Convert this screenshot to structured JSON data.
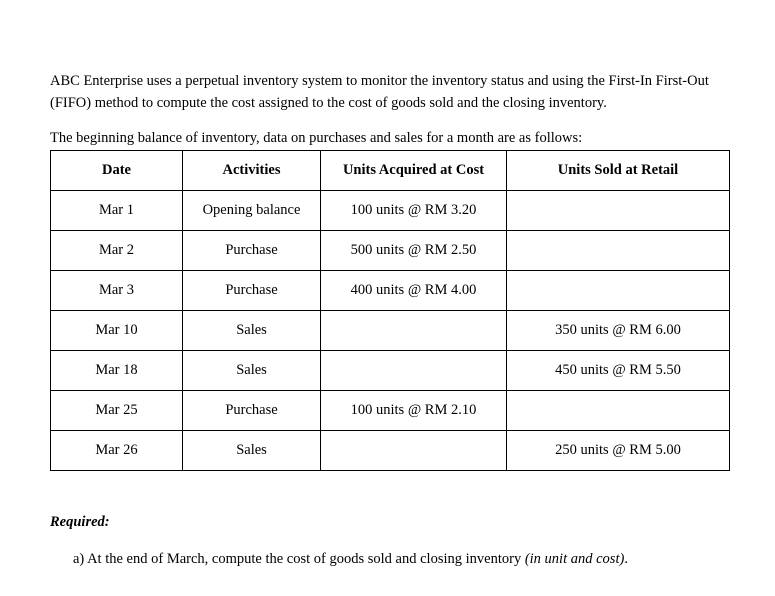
{
  "document": {
    "intro_paragraph": "ABC Enterprise uses a perpetual inventory system to monitor the inventory status and using the First-In First-Out (FIFO) method to compute the cost assigned to the cost of goods sold and the closing inventory.",
    "lead_in": "The beginning balance of inventory, data on purchases and sales for a month are as follows:"
  },
  "table": {
    "headers": {
      "date": "Date",
      "activities": "Activities",
      "acquired": "Units Acquired at Cost",
      "sold": "Units Sold at Retail"
    },
    "rows": [
      {
        "date": "Mar 1",
        "activity": "Opening balance",
        "acquired": "100 units @ RM 3.20",
        "sold": ""
      },
      {
        "date": "Mar 2",
        "activity": "Purchase",
        "acquired": "500 units @ RM 2.50",
        "sold": ""
      },
      {
        "date": "Mar 3",
        "activity": "Purchase",
        "acquired": "400 units @ RM 4.00",
        "sold": ""
      },
      {
        "date": "Mar 10",
        "activity": "Sales",
        "acquired": "",
        "sold": "350 units @ RM 6.00"
      },
      {
        "date": "Mar 18",
        "activity": "Sales",
        "acquired": "",
        "sold": "450 units @ RM 5.50"
      },
      {
        "date": "Mar 25",
        "activity": "Purchase",
        "acquired": "100 units @ RM 2.10",
        "sold": ""
      },
      {
        "date": "Mar 26",
        "activity": "Sales",
        "acquired": "",
        "sold": "250 units @ RM 5.00"
      }
    ]
  },
  "required": {
    "label": "Required:",
    "item_a_main": "a) At the end of March, compute the cost of goods sold and closing inventory ",
    "item_a_emphasis": "(in unit and cost)",
    "item_a_tail": "."
  },
  "colors": {
    "page_background": "#ffffff",
    "text": "#000000",
    "table_border": "#000000"
  }
}
